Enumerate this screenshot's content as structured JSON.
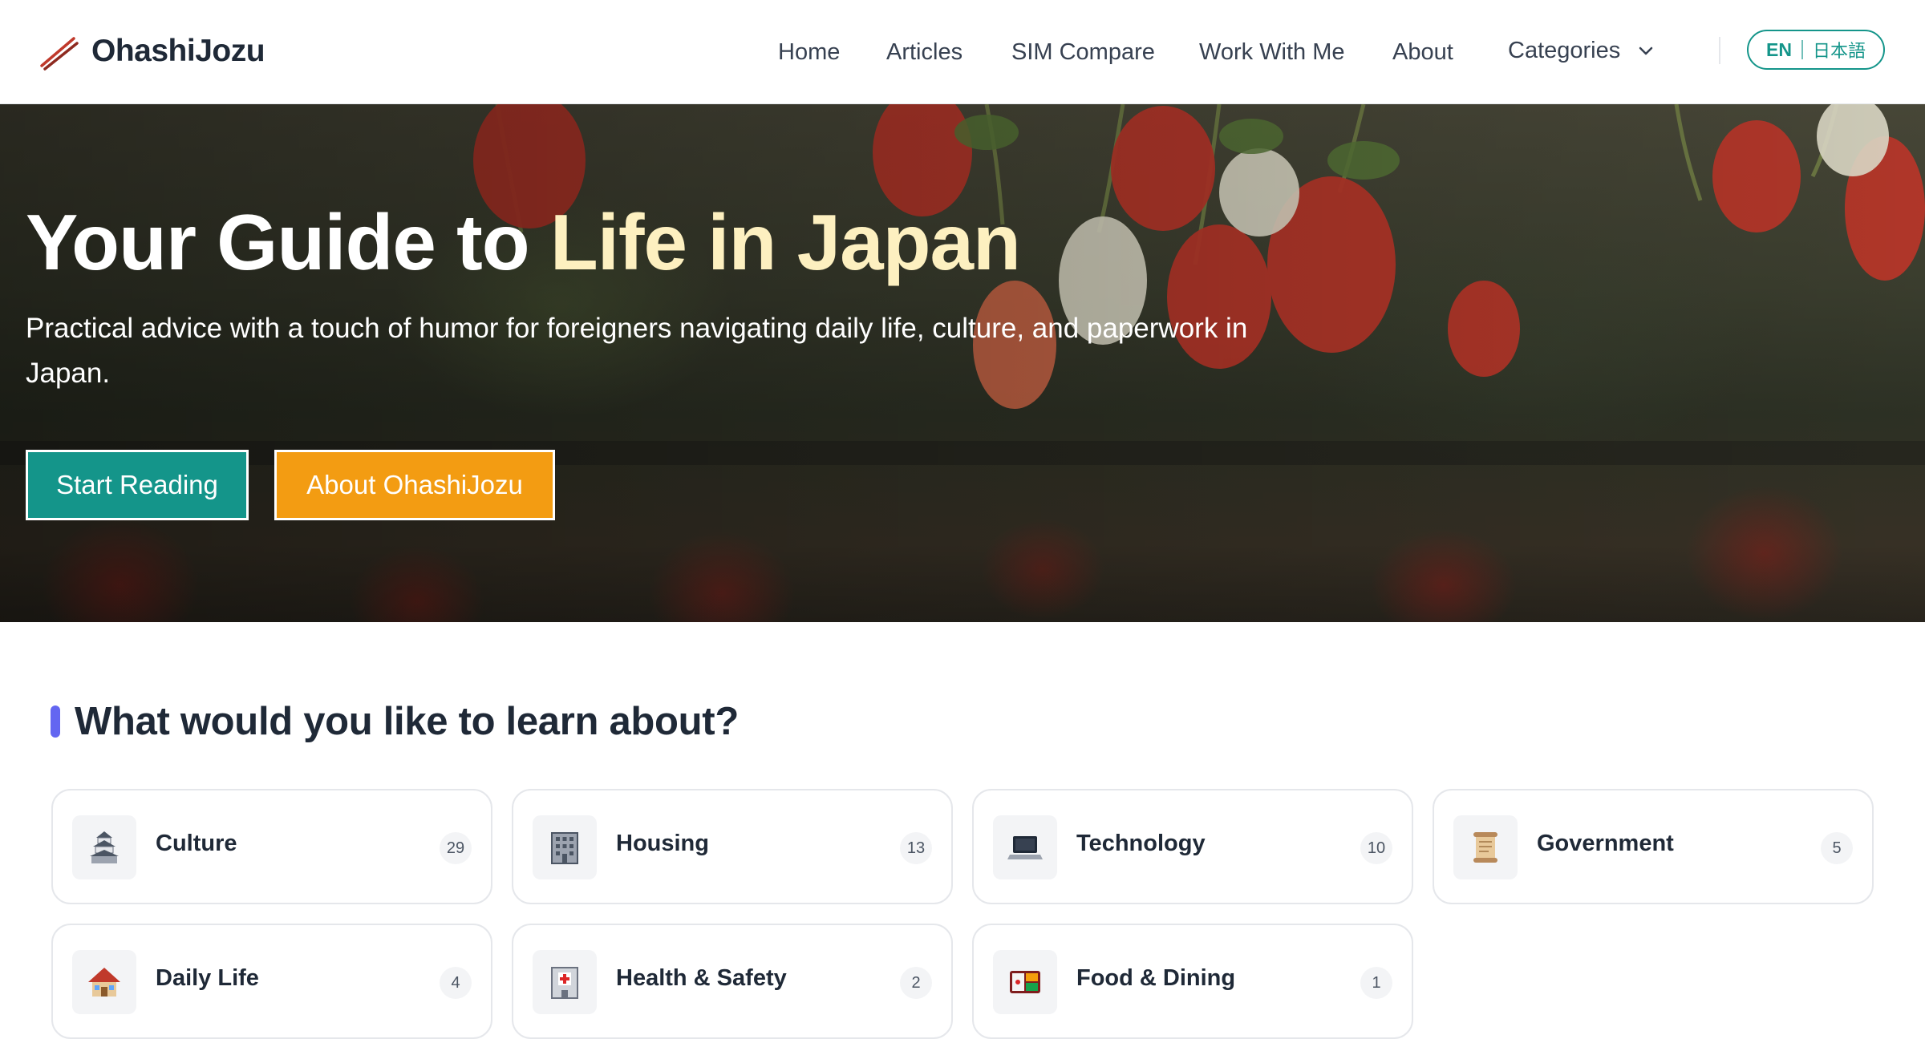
{
  "header": {
    "logo_text": "OhashiJozu",
    "nav": [
      "Home",
      "Articles",
      "SIM Compare",
      "Work With Me",
      "About"
    ],
    "categories_label": "Categories",
    "lang_en": "EN",
    "lang_ja": "日本語"
  },
  "hero": {
    "title_main": "Your Guide to ",
    "title_accent": "Life in Japan",
    "subtitle": "Practical advice with a touch of humor for foreigners navigating daily life, culture, and paperwork in Japan.",
    "primary_button": "Start Reading",
    "secondary_button": "About OhashiJozu"
  },
  "categories": {
    "heading": "What would you like to learn about?",
    "items": [
      {
        "label": "Culture",
        "count": "29",
        "icon": "japanese-castle-icon"
      },
      {
        "label": "Housing",
        "count": "13",
        "icon": "office-building-icon"
      },
      {
        "label": "Technology",
        "count": "10",
        "icon": "laptop-icon"
      },
      {
        "label": "Government",
        "count": "5",
        "icon": "scroll-icon"
      },
      {
        "label": "Daily Life",
        "count": "4",
        "icon": "house-icon"
      },
      {
        "label": "Health & Safety",
        "count": "2",
        "icon": "hospital-icon"
      },
      {
        "label": "Food & Dining",
        "count": "1",
        "icon": "bento-box-icon"
      }
    ]
  },
  "colors": {
    "teal": "#14958a",
    "orange": "#f39c12",
    "accent_bar": "#6366f1",
    "title_accent": "#fdf0c0"
  }
}
